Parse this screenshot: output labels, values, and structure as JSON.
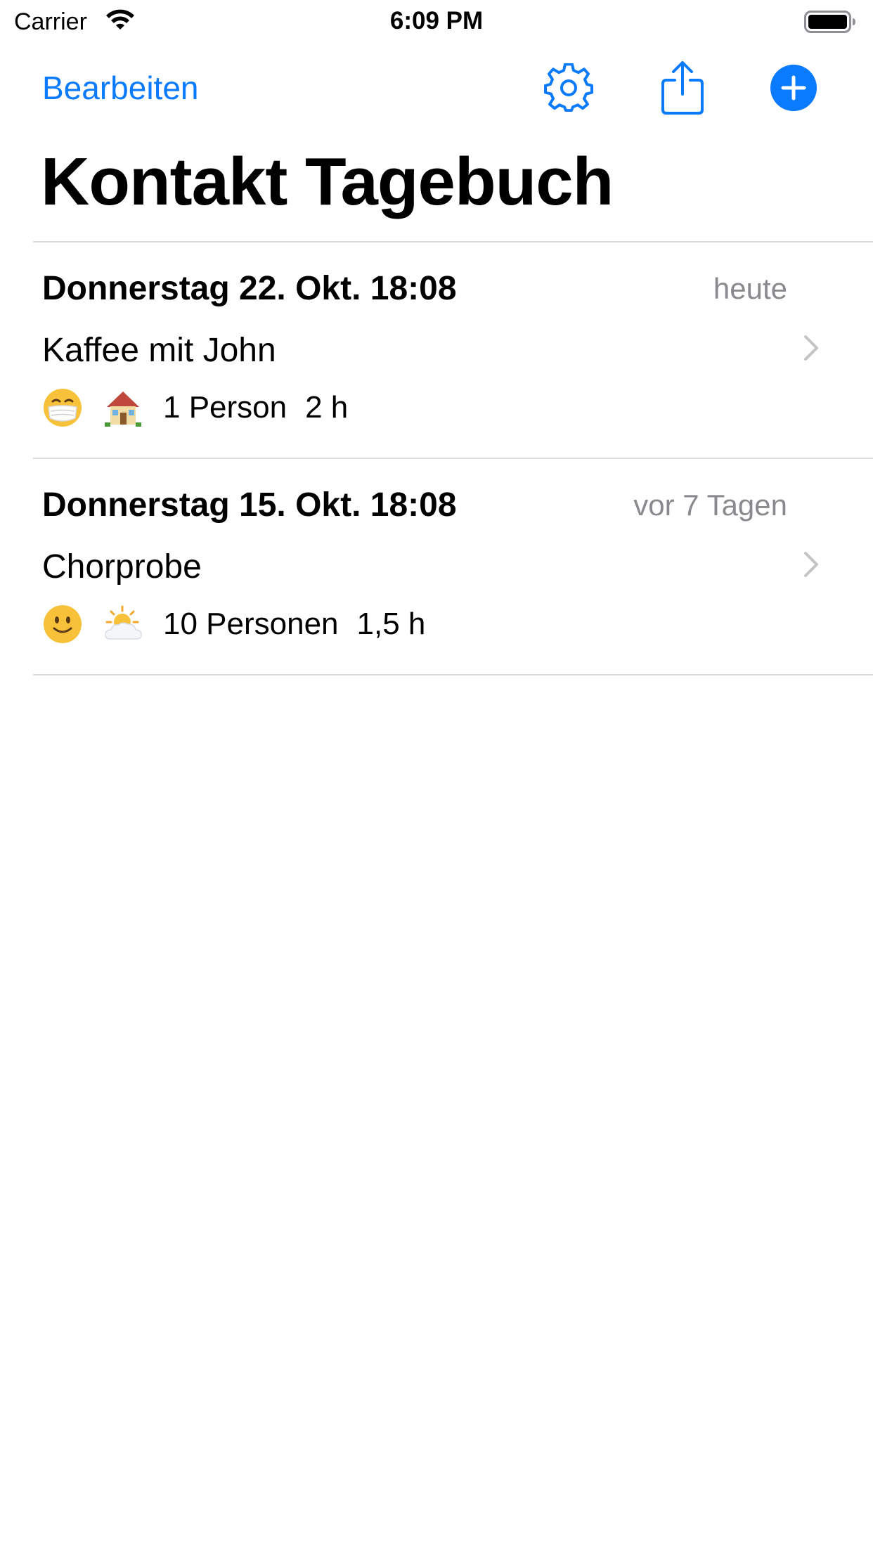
{
  "status_bar": {
    "carrier": "Carrier",
    "time": "6:09 PM",
    "icons": [
      "wifi-icon",
      "battery-icon"
    ]
  },
  "nav": {
    "edit_label": "Bearbeiten",
    "actions": [
      "settings-icon",
      "share-icon",
      "add-icon"
    ],
    "accent_color": "#0a7aff"
  },
  "page": {
    "title": "Kontakt Tagebuch"
  },
  "entries": [
    {
      "date": "Donnerstag 22. Okt. 18:08",
      "relative": "heute",
      "title": "Kaffee mit John",
      "mood_icon": "face-with-mask-icon",
      "location_icon": "house-icon",
      "persons": "1 Person",
      "duration": "2 h"
    },
    {
      "date": "Donnerstag 15. Okt. 18:08",
      "relative": "vor 7 Tagen",
      "title": "Chorprobe",
      "mood_icon": "slightly-smiling-face-icon",
      "location_icon": "sun-behind-cloud-icon",
      "persons": "10 Personen",
      "duration": "1,5 h"
    }
  ]
}
